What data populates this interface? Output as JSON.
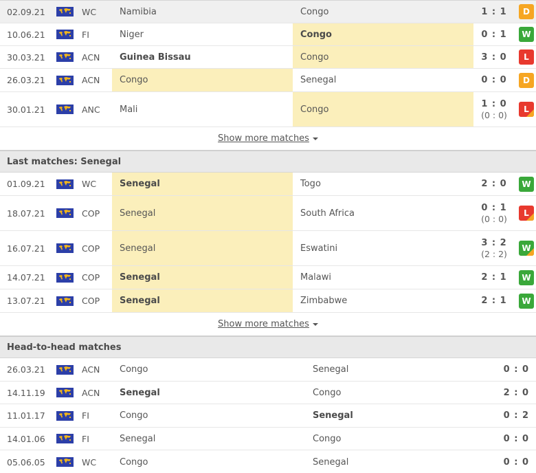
{
  "colors": {
    "highlight": "#fbefbb",
    "win": "#3aa83a",
    "loss": "#e8392e",
    "draw": "#f6a623",
    "header_bg": "#e9e9e9",
    "flag_blue": "#2c3fa8",
    "flag_gold": "#f2b61b"
  },
  "congo_matches": {
    "rows": [
      {
        "date": "02.09.21",
        "flag_icon": "world-flag-icon",
        "comp": "WC",
        "home": "Namibia",
        "away": "Congo",
        "score": "1 : 1",
        "sub_score": "",
        "result": "D",
        "extra": false,
        "home_hl": false,
        "away_hl": false,
        "home_bold": false,
        "away_bold": false,
        "hover": true
      },
      {
        "date": "10.06.21",
        "flag_icon": "world-flag-icon",
        "comp": "FI",
        "home": "Niger",
        "away": "Congo",
        "score": "0 : 1",
        "sub_score": "",
        "result": "W",
        "extra": false,
        "home_hl": false,
        "away_hl": true,
        "home_bold": false,
        "away_bold": true,
        "hover": false
      },
      {
        "date": "30.03.21",
        "flag_icon": "world-flag-icon",
        "comp": "ACN",
        "home": "Guinea Bissau",
        "away": "Congo",
        "score": "3 : 0",
        "sub_score": "",
        "result": "L",
        "extra": false,
        "home_hl": false,
        "away_hl": true,
        "home_bold": true,
        "away_bold": false,
        "hover": false
      },
      {
        "date": "26.03.21",
        "flag_icon": "world-flag-icon",
        "comp": "ACN",
        "home": "Congo",
        "away": "Senegal",
        "score": "0 : 0",
        "sub_score": "",
        "result": "D",
        "extra": false,
        "home_hl": true,
        "away_hl": false,
        "home_bold": false,
        "away_bold": false,
        "hover": false
      },
      {
        "date": "30.01.21",
        "flag_icon": "world-flag-icon",
        "comp": "ANC",
        "home": "Mali",
        "away": "Congo",
        "score": "1 : 0",
        "sub_score": "(0 : 0)",
        "result": "L",
        "extra": true,
        "home_hl": false,
        "away_hl": true,
        "home_bold": false,
        "away_bold": false,
        "hover": false
      }
    ],
    "show_more": "Show more matches"
  },
  "senegal_matches": {
    "title": "Last matches: Senegal",
    "rows": [
      {
        "date": "01.09.21",
        "flag_icon": "world-flag-icon",
        "comp": "WC",
        "home": "Senegal",
        "away": "Togo",
        "score": "2 : 0",
        "sub_score": "",
        "result": "W",
        "extra": false,
        "home_hl": true,
        "away_hl": false,
        "home_bold": true,
        "away_bold": false
      },
      {
        "date": "18.07.21",
        "flag_icon": "world-flag-icon",
        "comp": "COP",
        "home": "Senegal",
        "away": "South Africa",
        "score": "0 : 1",
        "sub_score": "(0 : 0)",
        "result": "L",
        "extra": true,
        "home_hl": true,
        "away_hl": false,
        "home_bold": false,
        "away_bold": false
      },
      {
        "date": "16.07.21",
        "flag_icon": "world-flag-icon",
        "comp": "COP",
        "home": "Senegal",
        "away": "Eswatini",
        "score": "3 : 2",
        "sub_score": "(2 : 2)",
        "result": "W",
        "extra": true,
        "home_hl": true,
        "away_hl": false,
        "home_bold": false,
        "away_bold": false
      },
      {
        "date": "14.07.21",
        "flag_icon": "world-flag-icon",
        "comp": "COP",
        "home": "Senegal",
        "away": "Malawi",
        "score": "2 : 1",
        "sub_score": "",
        "result": "W",
        "extra": false,
        "home_hl": true,
        "away_hl": false,
        "home_bold": true,
        "away_bold": false
      },
      {
        "date": "13.07.21",
        "flag_icon": "world-flag-icon",
        "comp": "COP",
        "home": "Senegal",
        "away": "Zimbabwe",
        "score": "2 : 1",
        "sub_score": "",
        "result": "W",
        "extra": false,
        "home_hl": true,
        "away_hl": false,
        "home_bold": true,
        "away_bold": false
      }
    ],
    "show_more": "Show more matches"
  },
  "head_to_head": {
    "title": "Head-to-head matches",
    "rows": [
      {
        "date": "26.03.21",
        "flag_icon": "world-flag-icon",
        "comp": "ACN",
        "home": "Congo",
        "away": "Senegal",
        "score": "0 : 0",
        "home_bold": false,
        "away_bold": false
      },
      {
        "date": "14.11.19",
        "flag_icon": "world-flag-icon",
        "comp": "ACN",
        "home": "Senegal",
        "away": "Congo",
        "score": "2 : 0",
        "home_bold": true,
        "away_bold": false
      },
      {
        "date": "11.01.17",
        "flag_icon": "world-flag-icon",
        "comp": "FI",
        "home": "Congo",
        "away": "Senegal",
        "score": "0 : 2",
        "home_bold": false,
        "away_bold": true
      },
      {
        "date": "14.01.06",
        "flag_icon": "world-flag-icon",
        "comp": "FI",
        "home": "Senegal",
        "away": "Congo",
        "score": "0 : 0",
        "home_bold": false,
        "away_bold": false
      },
      {
        "date": "05.06.05",
        "flag_icon": "world-flag-icon",
        "comp": "WC",
        "home": "Congo",
        "away": "Senegal",
        "score": "0 : 0",
        "home_bold": false,
        "away_bold": false
      }
    ]
  }
}
